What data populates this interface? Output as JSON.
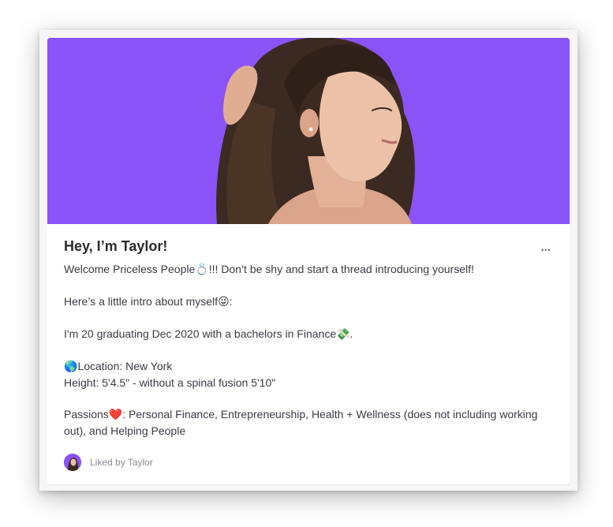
{
  "post": {
    "title": "Hey, I’m Taylor!",
    "more_label": "•••",
    "lines": {
      "welcome_a": "Welcome Priceless People",
      "welcome_emoji": "💍",
      "welcome_b": "!!! Don’t be shy and start a thread introducing yourself!",
      "intro_a": "Here’s a little intro about myself",
      "intro_emoji": "😜",
      "intro_b": ":",
      "age_a": "I'm 20 graduating Dec 2020 with a bachelors in Finance",
      "age_emoji": "💸",
      "age_b": ".",
      "location_emoji": "🌎",
      "location": "Location: New York",
      "height": "Height: 5'4.5\" - without a spinal fusion 5'10\"",
      "passions_a": "Passions",
      "passions_emoji": "❤️",
      "passions_b": ": Personal Finance, Entrepreneurship, Health + Wellness (does not including working out), and Helping People"
    },
    "liked_by": "Liked by Taylor"
  },
  "colors": {
    "hero_background": "#8a53f7",
    "title": "#2b2b30",
    "body_text": "#3a3a44",
    "muted": "#8b8b95"
  },
  "icons": {
    "more": "more-horizontal-icon",
    "avatar": "user-avatar"
  }
}
